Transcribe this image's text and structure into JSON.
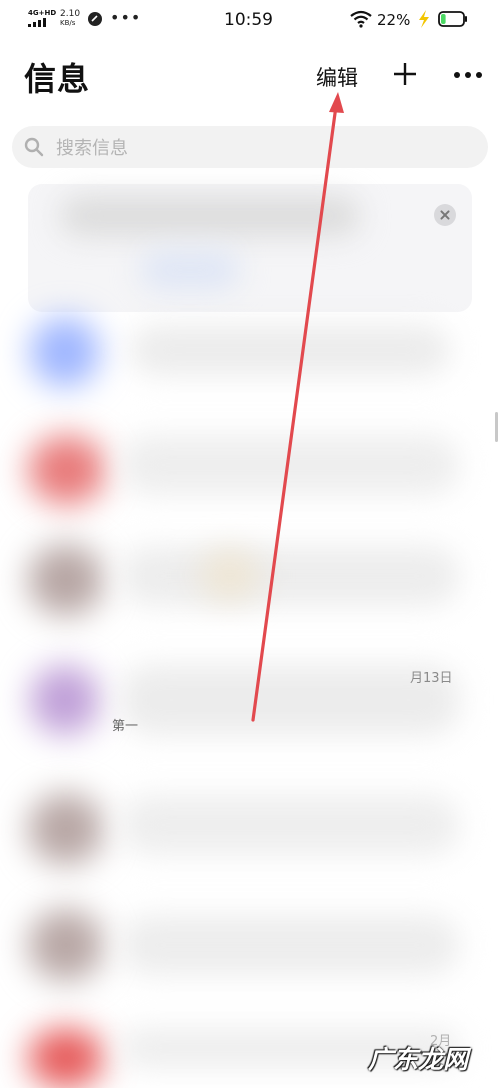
{
  "status_bar": {
    "network": "4G+HD",
    "speed_value": "2.10",
    "speed_unit": "KB/s",
    "more": "•••",
    "time": "10:59",
    "battery_percent": "22%",
    "battery_level": 0.22
  },
  "header": {
    "title": "信息",
    "edit_label": "编辑",
    "add_icon": "plus-icon",
    "more_icon": "more-dots-icon"
  },
  "search": {
    "placeholder": "搜索信息",
    "icon": "search-icon"
  },
  "conversations": {
    "visible_fragments": [
      {
        "date": "月13日"
      },
      {
        "snippet": "第一"
      },
      {
        "date": "2月"
      }
    ]
  },
  "annotation": {
    "arrow_color": "#e2494e"
  },
  "watermark": {
    "text": "广东龙网"
  },
  "colors": {
    "battery_green": "#4cd964",
    "charging_bolt": "#f2c500",
    "accent_arrow": "#e2494e"
  }
}
